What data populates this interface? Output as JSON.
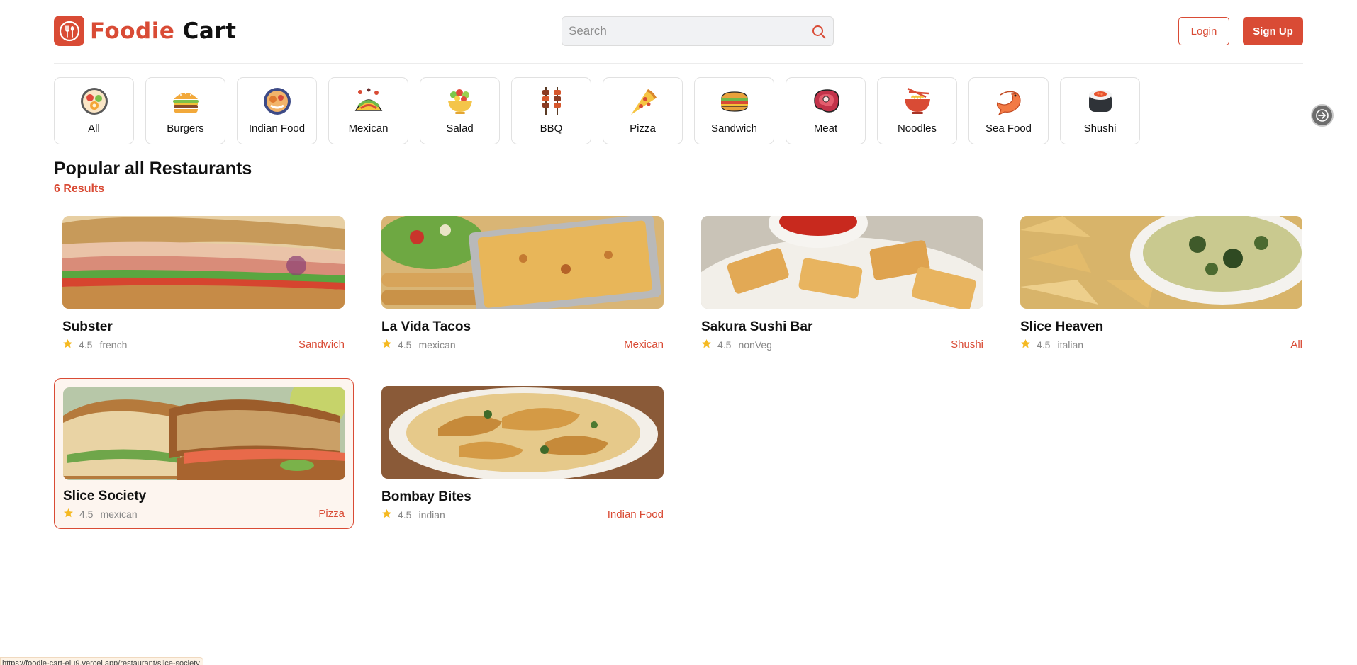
{
  "brand": {
    "name_a": "Foodie",
    "name_b": "Cart",
    "accent": "#d94b35"
  },
  "header": {
    "search_placeholder": "Search",
    "login_label": "Login",
    "signup_label": "Sign Up"
  },
  "categories": [
    {
      "label": "All",
      "icon": "food-plate-icon"
    },
    {
      "label": "Burgers",
      "icon": "burger-icon"
    },
    {
      "label": "Indian Food",
      "icon": "indian-thali-icon"
    },
    {
      "label": "Mexican",
      "icon": "taco-icon"
    },
    {
      "label": "Salad",
      "icon": "salad-icon"
    },
    {
      "label": "BBQ",
      "icon": "skewer-icon"
    },
    {
      "label": "Pizza",
      "icon": "pizza-icon"
    },
    {
      "label": "Sandwich",
      "icon": "sandwich-icon"
    },
    {
      "label": "Meat",
      "icon": "steak-icon"
    },
    {
      "label": "Noodles",
      "icon": "noodle-bowl-icon"
    },
    {
      "label": "Sea Food",
      "icon": "shrimp-icon"
    },
    {
      "label": "Shushi",
      "icon": "sushi-icon"
    }
  ],
  "section": {
    "title": "Popular all Restaurants",
    "count": "6 Results"
  },
  "restaurants": [
    {
      "name": "Subster",
      "rating": "4.5",
      "cuisine": "french",
      "category": "Sandwich",
      "image": "sub-sandwich-photo"
    },
    {
      "name": "La Vida Tacos",
      "rating": "4.5",
      "cuisine": "mexican",
      "category": "Mexican",
      "image": "lasagna-tray-photo"
    },
    {
      "name": "Sakura Sushi Bar",
      "rating": "4.5",
      "cuisine": "nonVeg",
      "category": "Shushi",
      "image": "fried-ravioli-photo"
    },
    {
      "name": "Slice Heaven",
      "rating": "4.5",
      "cuisine": "italian",
      "category": "All",
      "image": "spinach-dip-photo"
    },
    {
      "name": "Slice Society",
      "rating": "4.5",
      "cuisine": "mexican",
      "category": "Pizza",
      "image": "toasted-sandwich-photo"
    },
    {
      "name": "Bombay Bites",
      "rating": "4.5",
      "cuisine": "indian",
      "category": "Indian Food",
      "image": "chicken-pasta-photo"
    }
  ],
  "status_bar": {
    "url": "https://foodie-cart-eiu9.vercel.app/restaurant/slice-society"
  }
}
